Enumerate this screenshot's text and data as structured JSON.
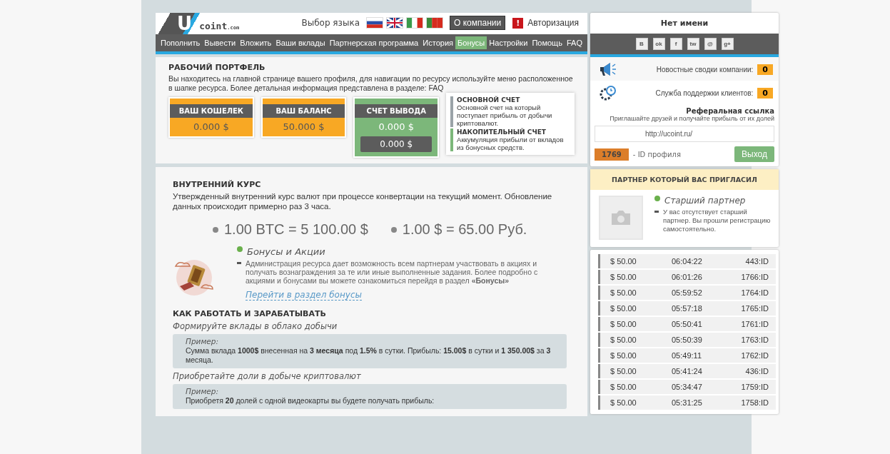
{
  "header": {
    "logo_letter": "U",
    "logo_text": "coint",
    "logo_domain": ".com",
    "language_label": "Выбор языка",
    "languages": [
      {
        "kind": "ru",
        "selected": false
      },
      {
        "kind": "gb",
        "selected": false
      },
      {
        "kind": "it",
        "selected": false
      },
      {
        "kind": "pt",
        "selected": false
      }
    ],
    "about_button": "О компании",
    "auth_mark": "!",
    "auth_link": "Авторизация"
  },
  "nav": [
    {
      "label": "Пополнить",
      "selected": false
    },
    {
      "label": "Вывести",
      "selected": false
    },
    {
      "label": "Вложить",
      "selected": false
    },
    {
      "label": "Ваши вклады",
      "selected": false
    },
    {
      "label": "Партнерская программа",
      "selected": false
    },
    {
      "label": "История",
      "selected": false
    },
    {
      "label": "Бонусы",
      "selected": true
    },
    {
      "label": "Настройки",
      "selected": false
    },
    {
      "label": "Помощь",
      "selected": false
    },
    {
      "label": "FAQ",
      "selected": false
    }
  ],
  "portfolio": {
    "title": "РАБОЧИЙ ПОРТФЕЛЬ",
    "text": "Вы находитесь на главной странице вашего профиля, для навигации по ресурсу используйте меню расположенное в шапке ресурса. Более детальная информация представлена в разделе: FAQ",
    "cards": [
      {
        "kind": "orange",
        "title": "ВАШ КОШЕЛЕК",
        "values": [
          "0.000 $"
        ]
      },
      {
        "kind": "orange",
        "title": "ВАШ БАЛАНС",
        "values": [
          "50.000 $"
        ]
      },
      {
        "kind": "green",
        "title": "СЧЕТ ВЫВОДА",
        "values": [
          "0.000 $",
          "0.000 $"
        ]
      }
    ],
    "notes": [
      {
        "title": "ОСНОВНОЙ СЧЕТ",
        "text": "Основной счет на который поступает прибыль от добычи криптовалют.",
        "color": "#9aa3a8"
      },
      {
        "title": "НАКОПИТЕЛЬНЫЙ СЧЕТ",
        "text": "Аккумуляция прибыли от вкладов из бонусных средств.",
        "color": "#7cb77a"
      }
    ]
  },
  "course": {
    "title": "ВНУТРЕННИЙ КУРС",
    "text": "Утвержденный внутренний курс валют при процессе конвертации на текущий момент. Обновление данных происходит примерно раз 3 часа.",
    "rates": [
      "1.00 BTC = 5 100.00 $",
      "1.00 $ = 65.00 Руб."
    ],
    "bonus": {
      "title": "Бонусы и Акции",
      "text": "Администрация ресурса дает возможность всем партнерам участвовать в акциях и получать вознаграждения за те или иные выполненные задания. Более подробно с акциями и бонусами вы можете ознакомиться перейдя в раздел **«Бонусы»**",
      "link": "Перейти в раздел бонусы"
    }
  },
  "how": {
    "title": "КАК РАБОТАТЬ И ЗАРАБАТЫВАТЬ",
    "items": [
      {
        "heading": "Формируйте вклады в облако добычи",
        "example_label": "Пример:",
        "example": "Сумма вклада **1000$** внесенная на **3 месяца** под **1.5%** в сутки. Прибыль: **15.00$** в сутки и **1 350.00$** за **3** месяца."
      },
      {
        "heading": "Приобретайте доли в добыче криптовалют",
        "example_label": "Пример:",
        "example": "Приобретя **20** долей с одной видеокарты вы будете получать прибыль:"
      }
    ]
  },
  "profile": {
    "name": "Нет имени",
    "socials": [
      "B",
      "ok",
      "f",
      "tw",
      "@",
      "g+"
    ],
    "stats": [
      {
        "kind": "news",
        "label": "Новостные сводки компании:",
        "count": "0"
      },
      {
        "kind": "support",
        "label": "Служба поддержки клиентов:",
        "count": "0"
      }
    ],
    "referral_title": "Реферальная ссылка",
    "referral_hint": "Приглашайте друзей и получайте прибыль от их долей",
    "referral_url": "http://ucoint.ru/",
    "id": "1769",
    "id_label": "- ID профиля",
    "logout": "Выход"
  },
  "partner": {
    "title": "ПАРТНЕР КОТОРЫЙ ВАС ПРИГЛАСИЛ",
    "role": "Старший партнер",
    "text": "У вас отсутствует старший партнер. Вы прошли регистрацию самостоятельно."
  },
  "transactions": [
    {
      "amount": "$ 50.00",
      "time": "06:04:22",
      "id": "443:ID"
    },
    {
      "amount": "$ 50.00",
      "time": "06:01:26",
      "id": "1766:ID"
    },
    {
      "amount": "$ 50.00",
      "time": "05:59:52",
      "id": "1764:ID"
    },
    {
      "amount": "$ 50.00",
      "time": "05:57:18",
      "id": "1765:ID"
    },
    {
      "amount": "$ 50.00",
      "time": "05:50:41",
      "id": "1761:ID"
    },
    {
      "amount": "$ 50.00",
      "time": "05:50:39",
      "id": "1763:ID"
    },
    {
      "amount": "$ 50.00",
      "time": "05:49:11",
      "id": "1762:ID"
    },
    {
      "amount": "$ 50.00",
      "time": "05:41:24",
      "id": "436:ID"
    },
    {
      "amount": "$ 50.00",
      "time": "05:34:47",
      "id": "1759:ID"
    },
    {
      "amount": "$ 50.00",
      "time": "05:31:25",
      "id": "1758:ID"
    }
  ]
}
